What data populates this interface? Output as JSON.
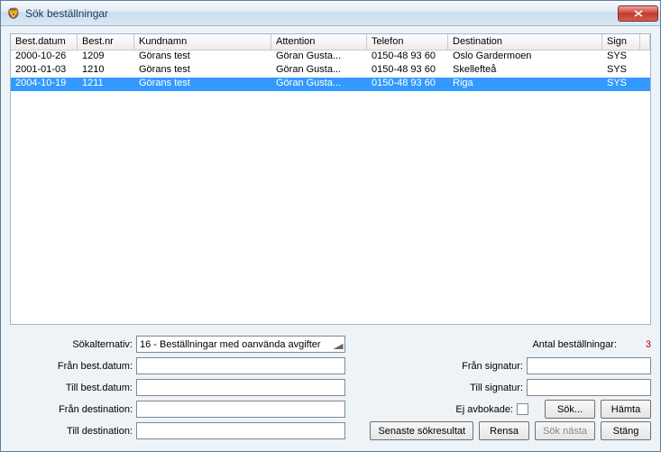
{
  "window": {
    "title": "Sök beställningar"
  },
  "table": {
    "headers": {
      "date": "Best.datum",
      "nr": "Best.nr",
      "name": "Kundnamn",
      "att": "Attention",
      "tel": "Telefon",
      "dest": "Destination",
      "sign": "Sign"
    },
    "rows": [
      {
        "date": "2000-10-26",
        "nr": "1209",
        "name": "Görans test",
        "att": "Göran Gusta...",
        "tel": "0150-48 93 60",
        "dest": "Oslo Gardermoen",
        "sign": "SYS",
        "selected": false
      },
      {
        "date": "2001-01-03",
        "nr": "1210",
        "name": "Görans test",
        "att": "Göran Gusta...",
        "tel": "0150-48 93 60",
        "dest": "Skellefteå",
        "sign": "SYS",
        "selected": false
      },
      {
        "date": "2004-10-19",
        "nr": "1211",
        "name": "Görans test",
        "att": "Göran Gusta...",
        "tel": "0150-48 93 60",
        "dest": "Riga",
        "sign": "SYS",
        "selected": true
      }
    ]
  },
  "form": {
    "sokalt_label": "Sökalternativ:",
    "sokalt_value": "16  - Beställningar med oanvända avgifter",
    "fran_best_label": "Från best.datum:",
    "fran_best_value": "",
    "till_best_label": "Till best.datum:",
    "till_best_value": "",
    "fran_dest_label": "Från destination:",
    "fran_dest_value": "",
    "till_dest_label": "Till destination:",
    "till_dest_value": "",
    "fran_sign_label": "Från signatur:",
    "fran_sign_value": "",
    "till_sign_label": "Till signatur:",
    "till_sign_value": "",
    "ej_avbok_label": "Ej avbokade:",
    "antal_label": "Antal beställningar:",
    "antal_value": "3"
  },
  "buttons": {
    "sok": "Sök...",
    "hamta": "Hämta",
    "senaste": "Senaste sökresultat",
    "rensa": "Rensa",
    "sok_nasta": "Sök nästa",
    "stang": "Stäng"
  }
}
